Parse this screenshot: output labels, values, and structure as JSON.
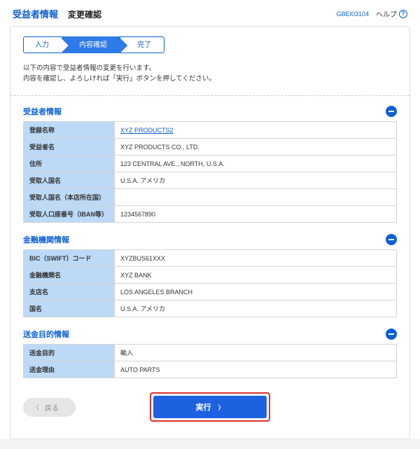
{
  "header": {
    "title": "受益者情報",
    "subtitle": "変更確認",
    "code": "GBEI03104",
    "help": "ヘルプ"
  },
  "steps": {
    "s1": "入力",
    "s2": "内容確認",
    "s3": "完了"
  },
  "intro": {
    "l1": "以下の内容で受益者情報の変更を行います。",
    "l2": "内容を確認し、よろしければ「実行」ボタンを押してください。"
  },
  "s1": {
    "title": "受益者情報",
    "r1l": "登録名称",
    "r1v": "XYZ PRODUCTS2",
    "r2l": "受益者名",
    "r2v": "XYZ PRODUCTS CO., LTD.",
    "r3l": "住所",
    "r3v": "123 CENTRAL AVE., NORTH, U.S.A.",
    "r4l": "受取人国名",
    "r4v": "U.S.A. アメリカ",
    "r5l": "受取人国名（本店所在国）",
    "r5v": "",
    "r6l": "受取人口座番号（IBAN等）",
    "r6v": "1234567890"
  },
  "s2": {
    "title": "金融機関情報",
    "r1l": "BIC（SWIFT）コード",
    "r1v": "XYZBUS61XXX",
    "r2l": "金融機関名",
    "r2v": "XYZ BANK",
    "r3l": "支店名",
    "r3v": "LOS ANGELES BRANCH",
    "r4l": "国名",
    "r4v": "U.S.A. アメリカ"
  },
  "s3": {
    "title": "送金目的情報",
    "r1l": "送金目的",
    "r1v": "輸入",
    "r2l": "送金理由",
    "r2v": "AUTO PARTS"
  },
  "btns": {
    "back": "戻る",
    "exec": "実行"
  }
}
